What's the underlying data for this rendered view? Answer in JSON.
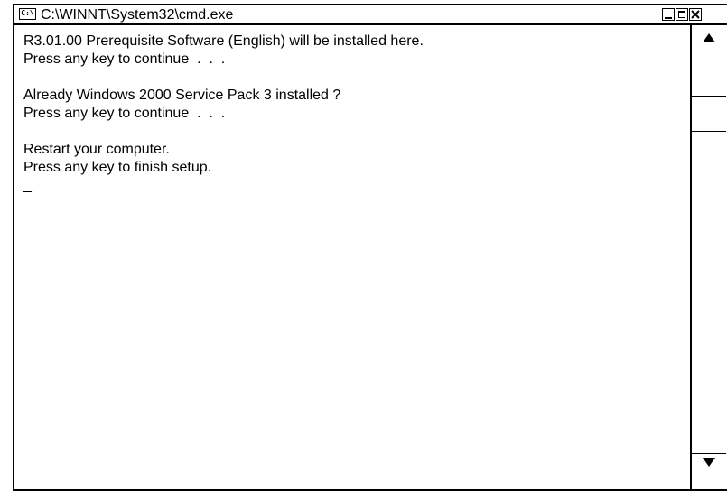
{
  "window": {
    "title": "C:\\WINNT\\System32\\cmd.exe",
    "app_icon_text": "C:\\",
    "buttons": {
      "minimize": "minimize-icon",
      "maximize": "maximize-icon",
      "close": "close-icon"
    }
  },
  "console": {
    "lines": [
      "R3.01.00 Prerequisite Software (English) will be installed here.",
      "Press any key to continue  .  .  .",
      "",
      "Already Windows 2000 Service Pack 3 installed ?",
      "Press any key to continue  .  .  .",
      "",
      "Restart your computer.",
      "Press any key to finish setup.",
      "_"
    ]
  },
  "scrollbar": {
    "up_icon": "up-arrow-icon",
    "down_icon": "down-arrow-icon"
  }
}
